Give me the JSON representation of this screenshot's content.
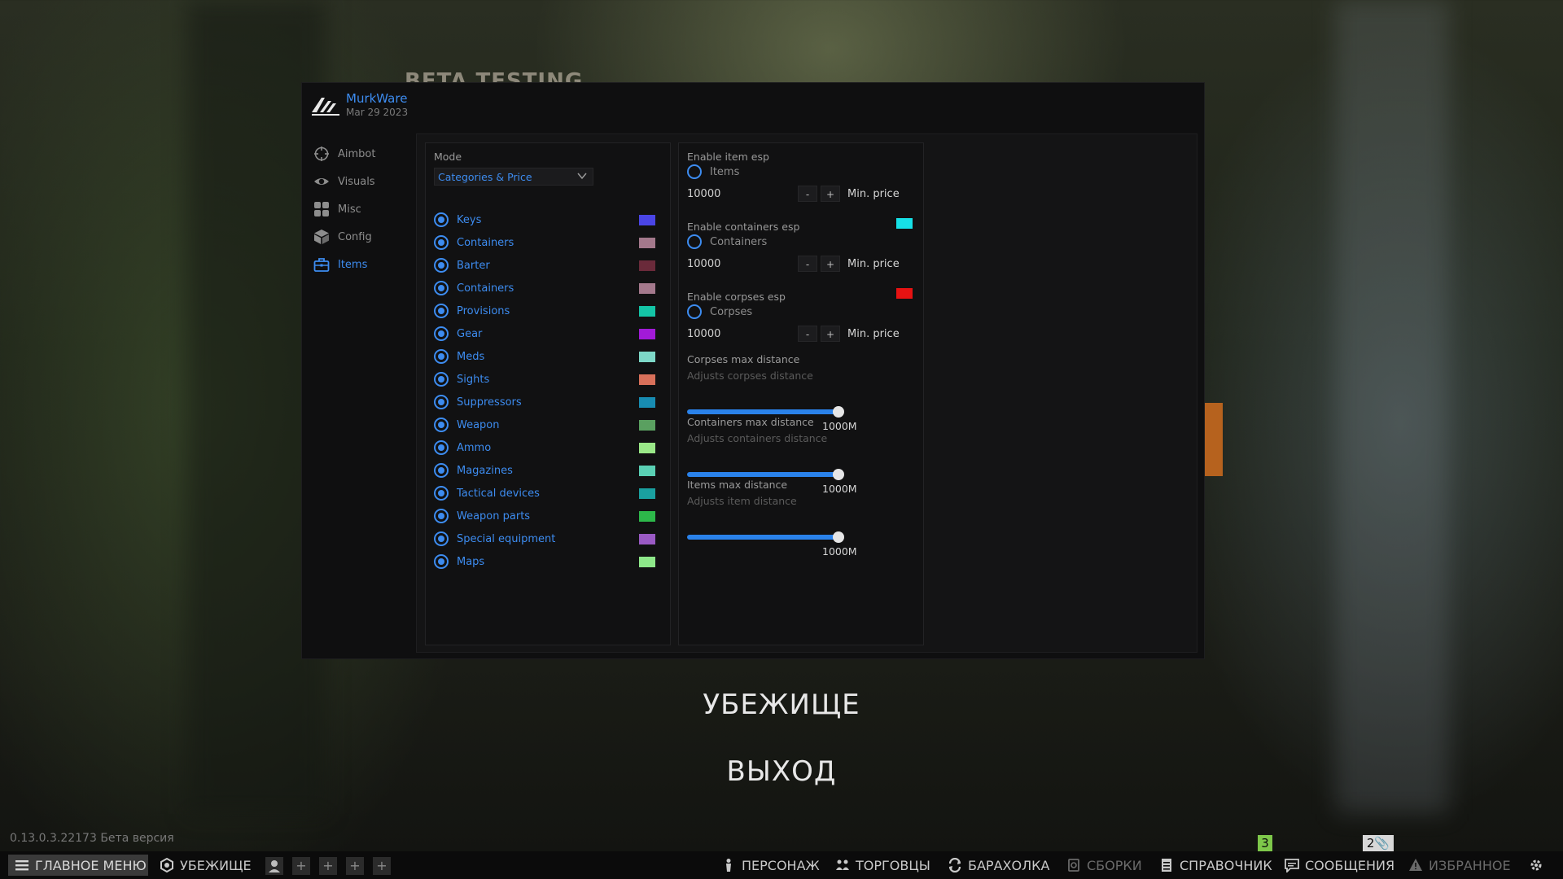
{
  "background": {
    "banner_text": "BETA TESTING"
  },
  "cheat": {
    "brand": {
      "name": "MurkWare",
      "date": "Mar 29 2023"
    },
    "nav": [
      {
        "label": "Aimbot",
        "icon": "crosshair-icon",
        "active": false
      },
      {
        "label": "Visuals",
        "icon": "eye-icon",
        "active": false
      },
      {
        "label": "Misc",
        "icon": "grid-icon",
        "active": false
      },
      {
        "label": "Config",
        "icon": "cube-icon",
        "active": false
      },
      {
        "label": "Items",
        "icon": "toolbox-icon",
        "active": true
      }
    ],
    "left_panel": {
      "mode_label": "Mode",
      "mode_value": "Categories & Price",
      "categories": [
        {
          "label": "Keys",
          "color": "#4a45e6",
          "checked": true
        },
        {
          "label": "Containers",
          "color": "#a4798c",
          "checked": true
        },
        {
          "label": "Barter",
          "color": "#6a2a3a",
          "checked": true
        },
        {
          "label": "Containers",
          "color": "#a4798c",
          "checked": true
        },
        {
          "label": "Provisions",
          "color": "#14c4a6",
          "checked": true
        },
        {
          "label": "Gear",
          "color": "#a21ad8",
          "checked": true
        },
        {
          "label": "Meds",
          "color": "#7ed8c8",
          "checked": true
        },
        {
          "label": "Sights",
          "color": "#d8705a",
          "checked": true
        },
        {
          "label": "Suppressors",
          "color": "#188cb2",
          "checked": true
        },
        {
          "label": "Weapon",
          "color": "#5aa060",
          "checked": true
        },
        {
          "label": "Ammo",
          "color": "#9ae888",
          "checked": true
        },
        {
          "label": "Magazines",
          "color": "#5ad0b4",
          "checked": true
        },
        {
          "label": "Tactical devices",
          "color": "#1aa0a0",
          "checked": true
        },
        {
          "label": "Weapon parts",
          "color": "#2db84a",
          "checked": true
        },
        {
          "label": "Special equipment",
          "color": "#9a5ac4",
          "checked": true
        },
        {
          "label": "Maps",
          "color": "#8ee88a",
          "checked": true
        }
      ]
    },
    "right_panel": {
      "items": {
        "enable_label": "Enable item esp",
        "radio_label": "Items",
        "price": "10000",
        "minus": "-",
        "plus": "+",
        "min_price_label": "Min. price"
      },
      "containers": {
        "enable_label": "Enable containers esp",
        "radio_label": "Containers",
        "price": "10000",
        "minus": "-",
        "plus": "+",
        "min_price_label": "Min. price",
        "color": "#16e0e6"
      },
      "corpses": {
        "enable_label": "Enable corpses esp",
        "radio_label": "Corpses",
        "price": "10000",
        "minus": "-",
        "plus": "+",
        "min_price_label": "Min. price",
        "color": "#e61212"
      },
      "sliders": [
        {
          "title": "Corpses max distance",
          "subtitle": "Adjusts corpses distance",
          "value": "1000M",
          "fraction": 1.0
        },
        {
          "title": "Containers max distance",
          "subtitle": "Adjusts containers distance",
          "value": "1000M",
          "fraction": 1.0
        },
        {
          "title": "Items max distance",
          "subtitle": "Adjusts item distance",
          "value": "1000M",
          "fraction": 1.0
        }
      ]
    }
  },
  "game": {
    "menu_hideout": "УБЕЖИЩЕ",
    "menu_exit": "ВЫХОД",
    "version": "0.13.0.3.22173 Бета версия",
    "bottom_bar": {
      "main_menu": "ГЛАВНОЕ МЕНЮ",
      "hideout": "УБЕЖИЩЕ",
      "character": "ПЕРСОНАЖ",
      "traders": "ТОРГОВЦЫ",
      "flea": "БАРАХОЛКА",
      "builds": "СБОРКИ",
      "handbook": "СПРАВОЧНИК",
      "messages": "СООБЩЕНИЯ",
      "favorites": "ИЗБРАННОЕ",
      "plus": "+",
      "badge_traders": "3",
      "badge_messages": "2"
    }
  }
}
